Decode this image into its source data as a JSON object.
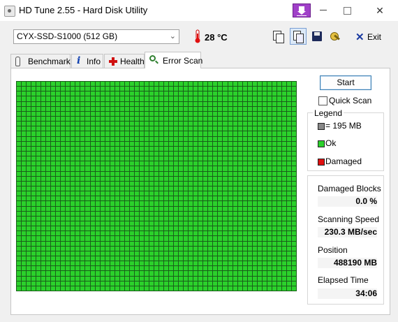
{
  "window": {
    "title": "HD Tune 2.55 - Hard Disk Utility"
  },
  "toolbar": {
    "drive": "CYX-SSD-S1000 (512 GB)",
    "temperature": "28 °C",
    "exit_label": "Exit"
  },
  "tabs": [
    {
      "label": "Benchmark",
      "active": false
    },
    {
      "label": "Info",
      "active": false
    },
    {
      "label": "Health",
      "active": false
    },
    {
      "label": "Error Scan",
      "active": true
    }
  ],
  "scan": {
    "start_label": "Start",
    "quick_scan_label": "Quick Scan",
    "quick_scan_checked": false,
    "grid_columns": 57,
    "grid_rows": 42,
    "block_colors": {
      "ok": "#2bd12b",
      "damaged": "#e01010",
      "unscanned": "#888888",
      "grid_line": "#1a5e1a"
    }
  },
  "legend": {
    "title": "Legend",
    "block_size": "= 195 MB",
    "ok": "Ok",
    "damaged": "Damaged"
  },
  "stats": {
    "damaged_blocks_label": "Damaged Blocks",
    "damaged_blocks_value": "0.0 %",
    "scanning_speed_label": "Scanning Speed",
    "scanning_speed_value": "230.3 MB/sec",
    "position_label": "Position",
    "position_value": "488190 MB",
    "elapsed_label": "Elapsed Time",
    "elapsed_value": "34:06"
  },
  "icons": [
    "app-icon",
    "download-icon",
    "minimize-icon",
    "maximize-icon",
    "close-icon",
    "chevron-down-icon",
    "thermometer-icon",
    "copy-icon",
    "info-copy-icon",
    "save-icon",
    "options-icon",
    "exit-icon",
    "benchmark-icon",
    "info-icon",
    "health-icon",
    "error-scan-icon"
  ]
}
